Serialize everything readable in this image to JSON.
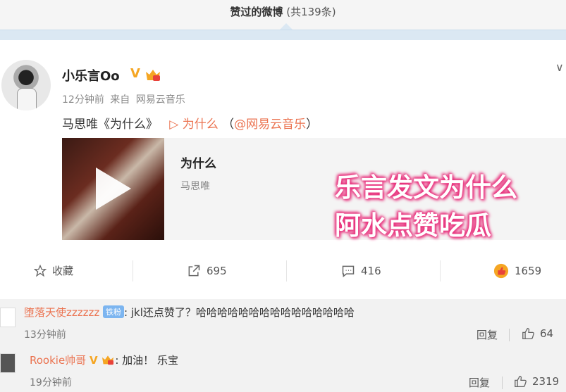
{
  "header": {
    "title": "赞过的微博",
    "count": "(共139条)"
  },
  "post": {
    "username": "小乐言Oo",
    "time": "12分钟前",
    "source_prefix": "来自",
    "source": "网易云音乐",
    "text_prefix": "马思唯《为什么》",
    "song_link": "▷ 为什么",
    "mention_open": "（",
    "mention": "@网易云音乐",
    "mention_close": "）",
    "music_card": {
      "title": "为什么",
      "artist": "马思唯"
    },
    "overlay_line1": "乐言发文为什么",
    "overlay_line2": "阿水点赞吃瓜"
  },
  "actions": {
    "favorite_label": "收藏",
    "repost_count": "695",
    "comment_count": "416",
    "like_count": "1659"
  },
  "comments": [
    {
      "name": "堕落天使zzzzzz",
      "badge": "铁粉",
      "text": ": jkl还点赞了？哈哈哈哈哈哈哈哈哈哈哈哈哈哈哈",
      "time": "13分钟前",
      "reply": "回复",
      "likes": "64"
    },
    {
      "name": "Rookie帅哥",
      "badge": "",
      "text": ": 加油！ 乐宝",
      "time": "19分钟前",
      "reply": "回复",
      "likes": "2319"
    }
  ],
  "colors": {
    "accent": "#eb7350",
    "overlay_glow": "#e8307c",
    "vip": "#f5a623"
  }
}
